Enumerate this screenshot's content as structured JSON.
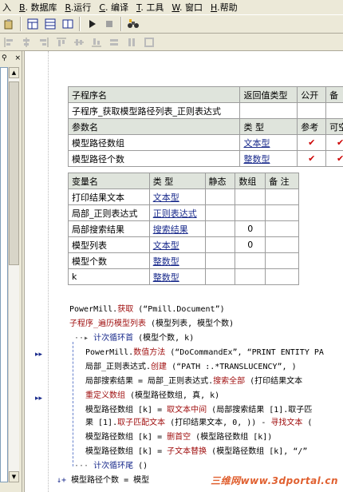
{
  "menu": [
    {
      "key": "",
      "label": "入"
    },
    {
      "key": "B",
      "label": ". 数据库"
    },
    {
      "key": "R",
      "label": ".运行"
    },
    {
      "key": "C",
      "label": ". 编译"
    },
    {
      "key": "T",
      "label": ". 工具"
    },
    {
      "key": "W",
      "label": ". 窗口"
    },
    {
      "key": "H",
      "label": ".帮助"
    }
  ],
  "left_panel": {
    "pin_glyph": "⚲",
    "close_glyph": "×"
  },
  "sub_table": {
    "headers": [
      "子程序名",
      "返回值类型",
      "公开",
      "备"
    ],
    "name": "子程序_获取模型路径列表_正则表达式"
  },
  "param_table": {
    "headers": [
      "参数名",
      "类 型",
      "参考",
      "可空"
    ],
    "rows": [
      {
        "name": "模型路径数组",
        "type": "文本型",
        "ref": "✔",
        "nullable": "✔"
      },
      {
        "name": "模型路径个数",
        "type": "整数型",
        "ref": "✔",
        "nullable": "✔"
      }
    ]
  },
  "var_table": {
    "headers": [
      "变量名",
      "类 型",
      "静态",
      "数组",
      "备 注"
    ],
    "rows": [
      {
        "name": "打印结果文本",
        "type": "文本型",
        "static": "",
        "array": "",
        "note": ""
      },
      {
        "name": "局部_正则表达式",
        "type": "正则表达式",
        "static": "",
        "array": "",
        "note": ""
      },
      {
        "name": "局部搜索结果",
        "type": "搜索结果",
        "static": "",
        "array": "0",
        "note": ""
      },
      {
        "name": "模型列表",
        "type": "文本型",
        "static": "",
        "array": "0",
        "note": ""
      },
      {
        "name": "模型个数",
        "type": "整数型",
        "static": "",
        "array": "",
        "note": ""
      },
      {
        "name": "k",
        "type": "整数型",
        "static": "",
        "array": "",
        "note": ""
      }
    ]
  },
  "code": {
    "l1a": "PowerMill.",
    "l1b": "获取",
    "l1c": " (“Pmill.Document”)",
    "l2a": "子程序_遍历模型列表",
    "l2b": " (模型列表, 模型个数)",
    "l3a": "计次循环首",
    "l3b": " (模型个数, k)",
    "l4a": "PowerMill.",
    "l4b": "数值方法",
    "l4c": " (“DoCommandEx”, “PRINT ENTITY PA",
    "l5a": "局部_正则表达式.",
    "l5b": "创建",
    "l5c": " (“PATH  :.*TRANSLUCENCY”, )",
    "l6a": "局部搜索结果 = 局部_正则表达式.",
    "l6b": "搜索全部",
    "l6c": " (打印结果文本",
    "l7a": "重定义数组",
    "l7b": " (模型路径数组, 真, k)",
    "l8a": "模型路径数组 [k] = ",
    "l8b": "取文本中间",
    "l8c": " (局部搜索结果 [1].取子匹",
    "l9a": "果 [1].",
    "l9b": "取子匹配文本",
    "l9c": " (打印结果文本, 0, )) - ",
    "l9d": "寻找文本",
    "l9e": " (",
    "l10a": "模型路径数组 [k] = ",
    "l10b": "删首空",
    "l10c": " (模型路径数组 [k])",
    "l11a": "模型路径数组 [k] = ",
    "l11b": "子文本替换",
    "l11c": " (模型路径数组 [k], “/”",
    "l12a": "计次循环尾",
    "l12b": " ()",
    "l13": "模型路径个数 = 模型"
  },
  "watermark": "三维网www.3dportal.cn",
  "colors": {
    "keyword": "#a01010",
    "string": "#1a6b1a",
    "type_link": "#1a2b8c",
    "header_bg": "#dfe4dc"
  }
}
